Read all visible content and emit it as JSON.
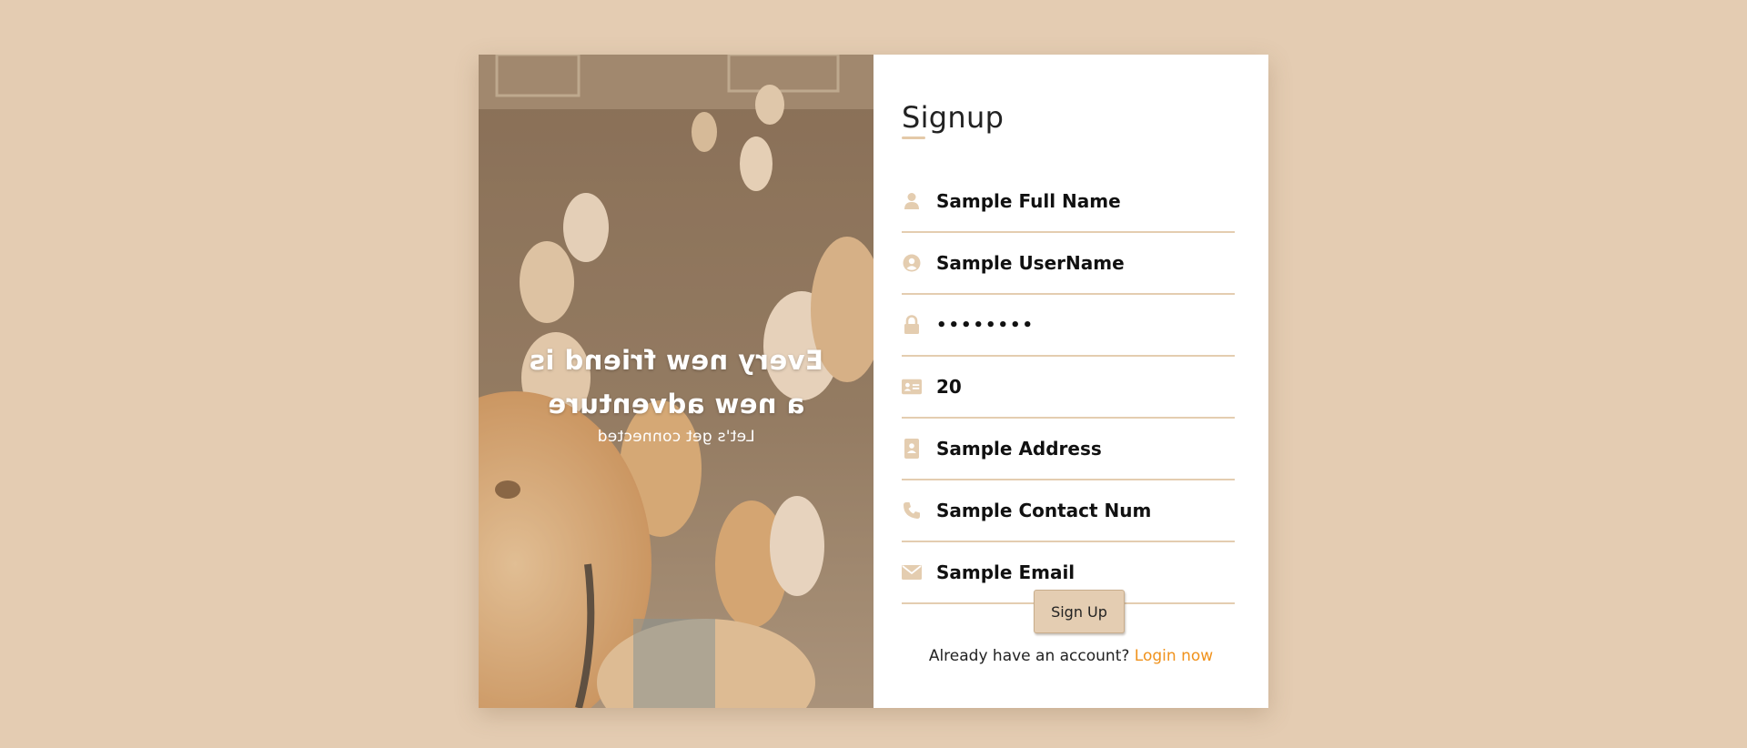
{
  "hero": {
    "heading": "Every new friend is a new adventure",
    "subheading": "Let's get connected"
  },
  "form": {
    "title": "Signup",
    "fields": [
      {
        "icon": "user-icon",
        "value": "Sample Full Name"
      },
      {
        "icon": "user-circle-icon",
        "value": "Sample UserName"
      },
      {
        "icon": "lock-icon",
        "value": "••••••••"
      },
      {
        "icon": "id-card-icon",
        "value": "20"
      },
      {
        "icon": "address-book-icon",
        "value": "Sample Address"
      },
      {
        "icon": "phone-icon",
        "value": "Sample Contact Num"
      },
      {
        "icon": "envelope-icon",
        "value": "Sample Email"
      }
    ],
    "submit_label": "Sign Up",
    "login_prompt": "Already have an account?",
    "login_link": "Login now"
  },
  "colors": {
    "background": "#e4ccb2",
    "accent": "#e4cdb2",
    "link": "#f0921c"
  }
}
